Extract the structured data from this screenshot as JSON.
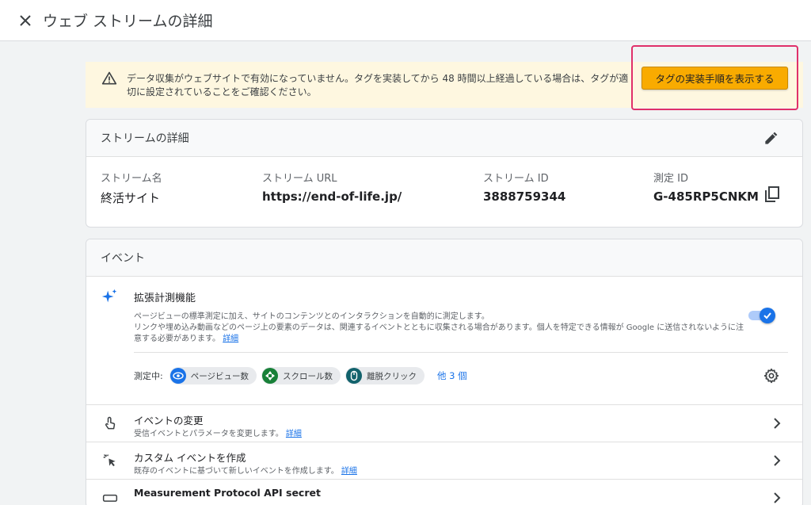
{
  "header": {
    "title": "ウェブ ストリームの詳細"
  },
  "banner": {
    "text": "データ収集がウェブサイトで有効になっていません。タグを実装してから 48 時間以上経過している場合は、タグが適切に設定されていることをご確認ください。",
    "button_label": "タグの実装手順を表示する",
    "colors": {
      "background": "#fef7e0",
      "button": "#f9ab00",
      "highlight": "#e0306a"
    }
  },
  "stream_details": {
    "title": "ストリームの詳細",
    "fields": [
      {
        "label": "ストリーム名",
        "value": "終活サイト"
      },
      {
        "label": "ストリーム URL",
        "value": "https://end-of-life.jp/"
      },
      {
        "label": "ストリーム ID",
        "value": "3888759344"
      },
      {
        "label": "測定 ID",
        "value": "G-485RP5CNKM"
      }
    ]
  },
  "events": {
    "title": "イベント",
    "enhanced": {
      "title": "拡張計測機能",
      "desc_line1": "ページビューの標準測定に加え、サイトのコンテンツとのインタラクションを自動的に測定します。",
      "desc_line2": "リンクや埋め込み動画などのページ上の要素のデータは、関連するイベントとともに収集される場合があります。個人を特定できる情報が Google に送信されないように注意する必要があります。",
      "detail_link": "詳細",
      "toggle_on": true,
      "measuring_label": "測定中:",
      "chips": [
        {
          "label": "ページビュー数",
          "icon": "eye-icon",
          "color": "#1a73e8"
        },
        {
          "label": "スクロール数",
          "icon": "scroll-icon",
          "color": "#188038"
        },
        {
          "label": "離脱クリック",
          "icon": "mouse-icon",
          "color": "#12626c"
        }
      ],
      "more_label": "他 3 個"
    },
    "rows": [
      {
        "title": "イベントの変更",
        "subtitle": "受信イベントとパラメータを変更します。",
        "link": "詳細",
        "icon": "touch-icon"
      },
      {
        "title": "カスタム イベントを作成",
        "subtitle": "既存のイベントに基づいて新しいイベントを作成します。",
        "link": "詳細",
        "icon": "sparkle-click-icon"
      },
      {
        "title": "Measurement Protocol API secret",
        "subtitle": "",
        "link": "",
        "icon": "key-icon"
      }
    ]
  }
}
